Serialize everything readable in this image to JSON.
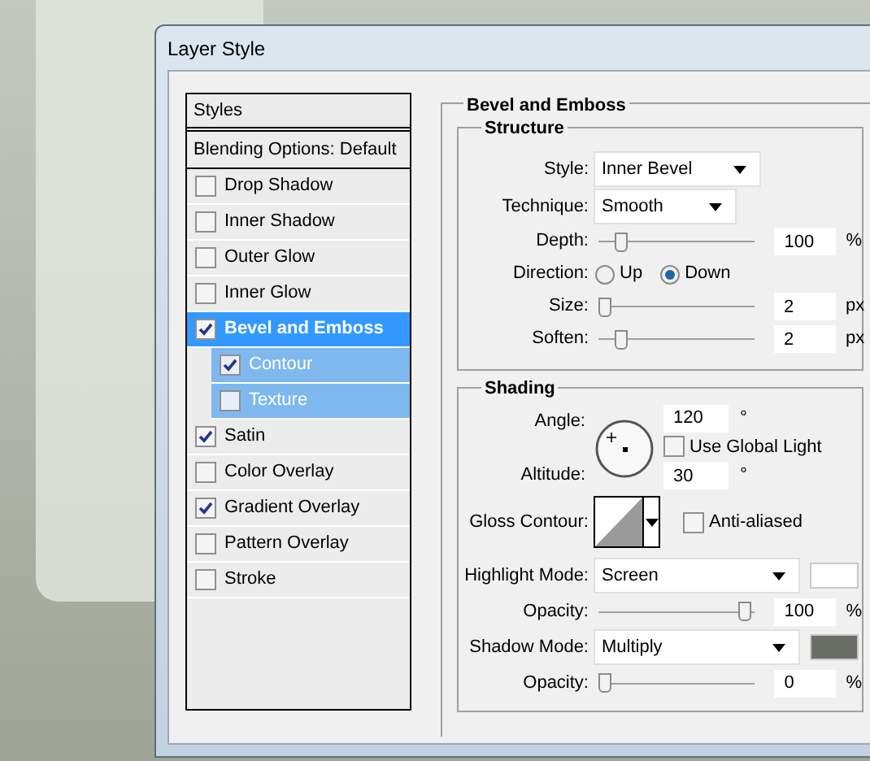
{
  "window": {
    "title": "Layer Style"
  },
  "styles_list": {
    "header": "Styles",
    "blending": "Blending Options: Default",
    "items": [
      {
        "label": "Drop Shadow",
        "checked": false,
        "selected": false
      },
      {
        "label": "Inner Shadow",
        "checked": false,
        "selected": false
      },
      {
        "label": "Outer Glow",
        "checked": false,
        "selected": false
      },
      {
        "label": "Inner Glow",
        "checked": false,
        "selected": false
      },
      {
        "label": "Bevel and Emboss",
        "checked": true,
        "selected": true,
        "children": [
          {
            "label": "Contour",
            "checked": true,
            "selected": false
          },
          {
            "label": "Texture",
            "checked": false,
            "selected": false
          }
        ]
      },
      {
        "label": "Satin",
        "checked": true,
        "selected": false
      },
      {
        "label": "Color Overlay",
        "checked": false,
        "selected": false
      },
      {
        "label": "Gradient Overlay",
        "checked": true,
        "selected": false
      },
      {
        "label": "Pattern Overlay",
        "checked": false,
        "selected": false
      },
      {
        "label": "Stroke",
        "checked": false,
        "selected": false
      }
    ]
  },
  "panel": {
    "title": "Bevel and Emboss",
    "structure": {
      "title": "Structure",
      "rows": [
        {
          "kind": "select",
          "label": "Style:",
          "value": "Inner Bevel"
        },
        {
          "kind": "select",
          "label": "Technique:",
          "value": "Smooth"
        },
        {
          "kind": "slider",
          "label": "Depth:",
          "level": 0.12,
          "value": "100",
          "unit": "%"
        },
        {
          "kind": "radio",
          "label": "Direction:",
          "options": [
            {
              "label": "Up",
              "selected": false
            },
            {
              "label": "Down",
              "selected": true
            }
          ]
        },
        {
          "kind": "slider",
          "label": "Size:",
          "level": 0,
          "value": "2",
          "unit": "px"
        },
        {
          "kind": "slider",
          "label": "Soften:",
          "level": 0.12,
          "value": "2",
          "unit": "px"
        }
      ]
    },
    "shading": {
      "title": "Shading",
      "angle": {
        "label": "Angle:",
        "value": "120",
        "unit": "°"
      },
      "global_light": {
        "label": "Use Global Light",
        "checked": false
      },
      "altitude": {
        "label": "Altitude:",
        "value": "30",
        "unit": "°"
      },
      "gloss_contour": {
        "label": "Gloss Contour:"
      },
      "anti_aliased": {
        "label": "Anti-aliased",
        "checked": false
      },
      "rows": [
        {
          "kind": "mode",
          "label": "Highlight Mode:",
          "value": "Screen",
          "color": "#ffffff"
        },
        {
          "kind": "slider",
          "label": "Opacity:",
          "level": 1,
          "value": "100",
          "unit": "%"
        },
        {
          "kind": "mode",
          "label": "Shadow Mode:",
          "value": "Multiply",
          "color": "#6b6e66"
        },
        {
          "kind": "slider",
          "label": "Opacity:",
          "level": 0,
          "value": "0",
          "unit": "%"
        }
      ]
    }
  }
}
